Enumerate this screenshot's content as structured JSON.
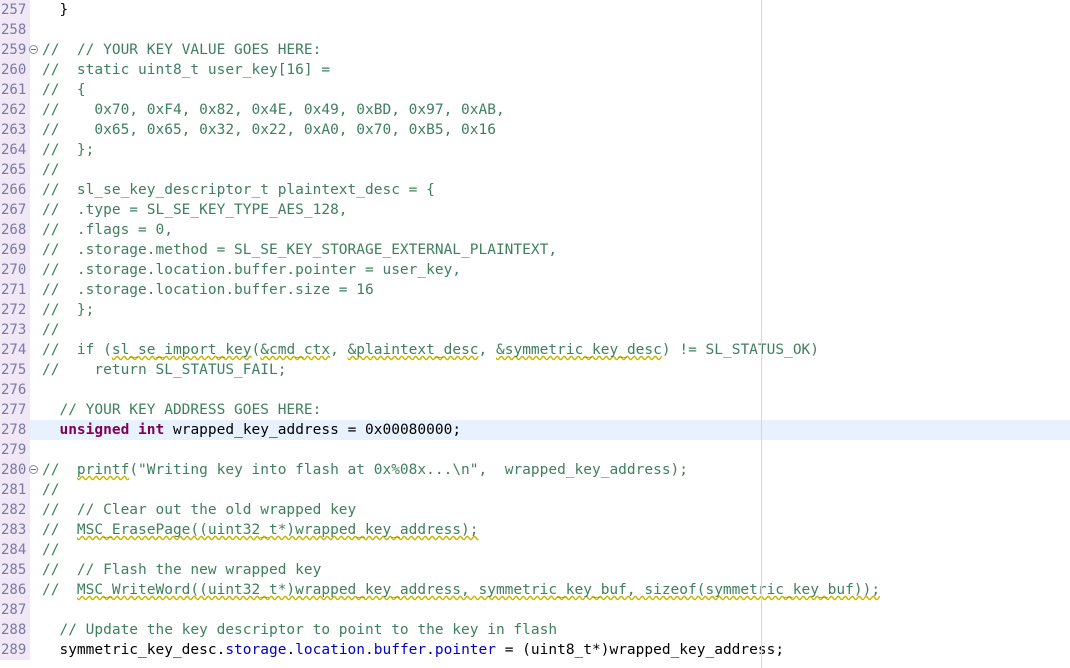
{
  "editor": {
    "lines": [
      {
        "n": "257",
        "code": "  }"
      },
      {
        "n": "258",
        "code": ""
      },
      {
        "n": "259",
        "code": "//  // YOUR KEY VALUE GOES HERE:",
        "fold": true
      },
      {
        "n": "260",
        "code": "//  static uint8_t user_key[16] ="
      },
      {
        "n": "261",
        "code": "//  {"
      },
      {
        "n": "262",
        "code": "//    0x70, 0xF4, 0x82, 0x4E, 0x49, 0xBD, 0x97, 0xAB,"
      },
      {
        "n": "263",
        "code": "//    0x65, 0x65, 0x32, 0x22, 0xA0, 0x70, 0xB5, 0x16"
      },
      {
        "n": "264",
        "code": "//  };"
      },
      {
        "n": "265",
        "code": "//"
      },
      {
        "n": "266",
        "code": "//  sl_se_key_descriptor_t plaintext_desc = {"
      },
      {
        "n": "267",
        "code": "//  .type = SL_SE_KEY_TYPE_AES_128,"
      },
      {
        "n": "268",
        "code": "//  .flags = 0,"
      },
      {
        "n": "269",
        "code": "//  .storage.method = SL_SE_KEY_STORAGE_EXTERNAL_PLAINTEXT,"
      },
      {
        "n": "270",
        "code": "//  .storage.location.buffer.pointer = user_key,"
      },
      {
        "n": "271",
        "code": "//  .storage.location.buffer.size = 16"
      },
      {
        "n": "272",
        "code": "//  };"
      },
      {
        "n": "273",
        "code": "//"
      },
      {
        "n": "274",
        "code": "//  if (sl_se_import_key(&cmd_ctx, &plaintext_desc, &symmetric_key_desc) != SL_STATUS_OK)"
      },
      {
        "n": "275",
        "code": "//    return SL_STATUS_FAIL;"
      },
      {
        "n": "276",
        "code": ""
      },
      {
        "n": "277",
        "code": "  // YOUR KEY ADDRESS GOES HERE:"
      },
      {
        "n": "278",
        "code": "  unsigned int wrapped_key_address = 0x00080000;",
        "current": true
      },
      {
        "n": "279",
        "code": ""
      },
      {
        "n": "280",
        "code": "//  printf(\"Writing key into flash at 0x%08x...\\n\",  wrapped_key_address);",
        "fold": true
      },
      {
        "n": "281",
        "code": "//"
      },
      {
        "n": "282",
        "code": "//  // Clear out the old wrapped key"
      },
      {
        "n": "283",
        "code": "//  MSC_ErasePage((uint32_t*)wrapped_key_address);"
      },
      {
        "n": "284",
        "code": "//"
      },
      {
        "n": "285",
        "code": "//  // Flash the new wrapped key"
      },
      {
        "n": "286",
        "code": "//  MSC_WriteWord((uint32_t*)wrapped_key_address, symmetric_key_buf, sizeof(symmetric_key_buf));"
      },
      {
        "n": "287",
        "code": ""
      },
      {
        "n": "288",
        "code": "  // Update the key descriptor to point to the key in flash"
      },
      {
        "n": "289",
        "code": "  symmetric_key_desc.storage.location.buffer.pointer = (uint8_t*)wrapped_key_address;"
      }
    ]
  }
}
